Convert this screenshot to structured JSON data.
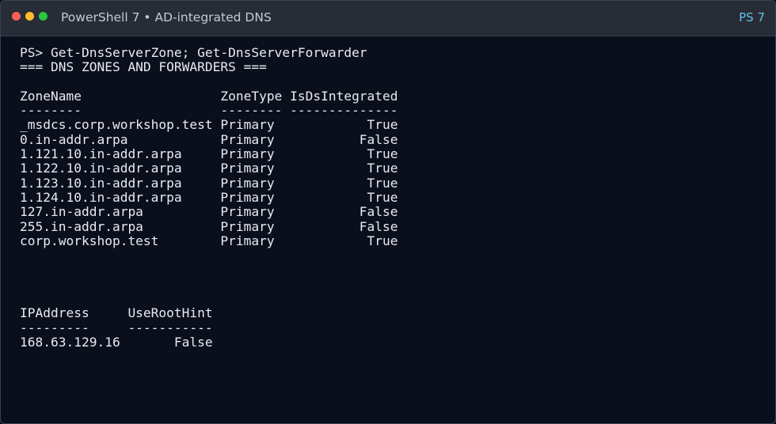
{
  "window": {
    "title": "PowerShell 7 • AD-integrated DNS",
    "badge": "PS 7"
  },
  "terminal": {
    "lines": [
      "PS> Get-DnsServerZone; Get-DnsServerForwarder",
      "=== DNS ZONES AND FORWARDERS ===",
      "",
      "ZoneName                  ZoneType IsDsIntegrated",
      "--------                  -------- --------------",
      "_msdcs.corp.workshop.test Primary            True",
      "0.in-addr.arpa            Primary           False",
      "1.121.10.in-addr.arpa     Primary            True",
      "1.122.10.in-addr.arpa     Primary            True",
      "1.123.10.in-addr.arpa     Primary            True",
      "1.124.10.in-addr.arpa     Primary            True",
      "127.in-addr.arpa          Primary           False",
      "255.in-addr.arpa          Primary           False",
      "corp.workshop.test        Primary            True",
      "",
      "",
      "",
      "",
      "IPAddress     UseRootHint",
      "---------     -----------",
      "168.63.129.16       False"
    ]
  }
}
